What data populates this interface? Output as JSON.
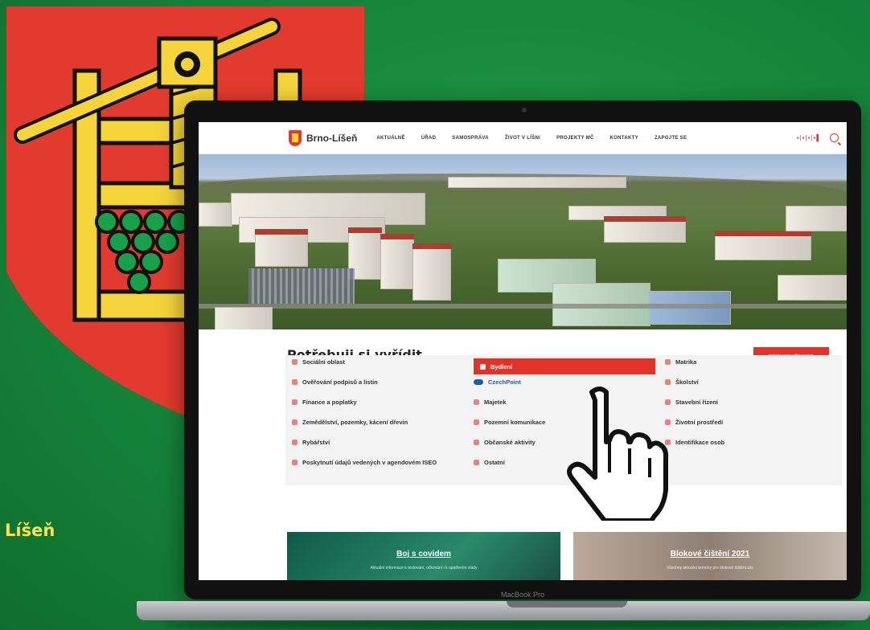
{
  "crest": {
    "colors": {
      "red": "#e23a2e",
      "yellow": "#f4d43a",
      "green": "#18a14a"
    }
  },
  "side_label": "Líšeň",
  "laptop": {
    "bezel_label": "MacBook Pro"
  },
  "site": {
    "logo_text": "Brno-Líšeň",
    "nav": [
      "AKTUÁLNĚ",
      "ÚŘAD",
      "SAMOSPRÁVA",
      "ŽIVOT V LÍŠNI",
      "PROJEKTY MČ",
      "KONTAKTY",
      "ZAPOJTE SE"
    ],
    "header_dots": "▪|▪|▪|▪▌",
    "section": {
      "title": "Potřebuji si vyřídit",
      "button": "ZOBRAZIT VŠECHNO",
      "columns": [
        [
          {
            "label": "Sociální oblast",
            "icon": "people-icon"
          },
          {
            "label": "Ověřování podpisů a listin",
            "icon": "stamp-icon"
          },
          {
            "label": "Finance a poplatky",
            "icon": "wallet-icon"
          },
          {
            "label": "Zemědělství, pozemky, kácení dřevin",
            "icon": "tree-icon"
          },
          {
            "label": "Rybářství",
            "icon": "fish-icon"
          },
          {
            "label": "Poskytnutí údajů vedených v agendovém ISEO",
            "icon": "database-icon"
          }
        ],
        [
          {
            "label": "Bydlení",
            "icon": "house-icon",
            "active": true
          },
          {
            "label": "CzechPoint",
            "icon": "czechpoint-icon"
          },
          {
            "label": "Majetek",
            "icon": "document-icon"
          },
          {
            "label": "Pozemní komunikace",
            "icon": "road-icon"
          },
          {
            "label": "Občanské aktivity",
            "icon": "warning-icon"
          },
          {
            "label": "Ostatní",
            "icon": "mail-icon"
          }
        ],
        [
          {
            "label": "Matrika",
            "icon": "person-icon"
          },
          {
            "label": "Školství",
            "icon": "book-icon"
          },
          {
            "label": "Stavební řízení",
            "icon": "crane-icon"
          },
          {
            "label": "Životní prostředí",
            "icon": "leaf-icon"
          },
          {
            "label": "Identifikace osob",
            "icon": "id-icon"
          }
        ]
      ]
    },
    "cards": [
      {
        "title": "Boj s covidem",
        "subtitle": "Aktuální informace k testování, očkování i k opatřením vlády"
      },
      {
        "title": "Blokové čištění 2021",
        "subtitle": "Všechny aktuální termíny pro blokové čištění ulic"
      }
    ]
  }
}
